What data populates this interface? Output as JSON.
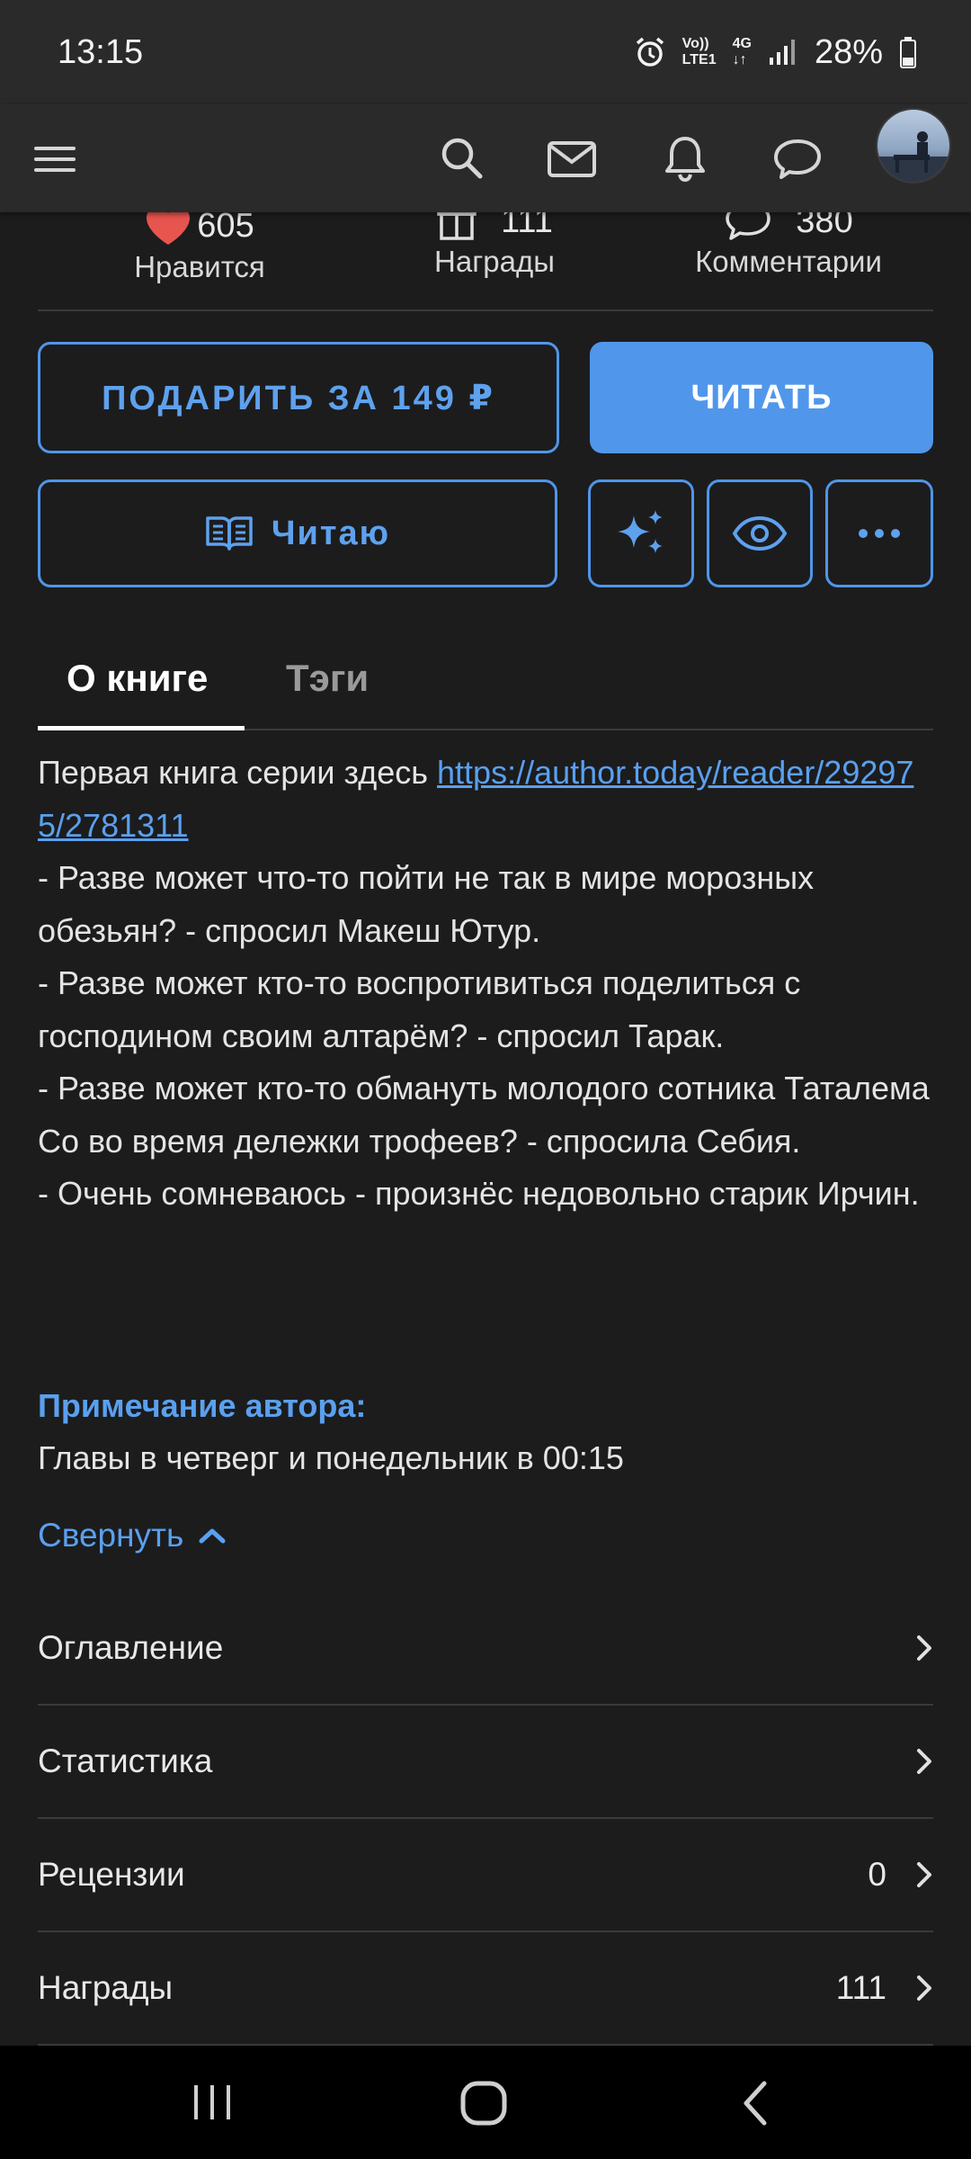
{
  "status_bar": {
    "time": "13:15",
    "volte_top": "Vo))",
    "volte_bottom": "LTE1",
    "network_top": "4G",
    "network_bottom": "↓↑",
    "battery": "28%"
  },
  "app_bar": {
    "icons": [
      "menu-icon",
      "search-icon",
      "mail-icon",
      "bell-icon",
      "chat-icon",
      "avatar"
    ]
  },
  "stats": {
    "likes": {
      "value": "605",
      "label": "Нравится"
    },
    "awards": {
      "value": "111",
      "label": "Награды"
    },
    "comments": {
      "value": "380",
      "label": "Комментарии"
    }
  },
  "actions": {
    "gift_label": "ПОДАРИТЬ ЗА 149 ₽",
    "read_label": "ЧИТАТЬ",
    "reading_label": "Читаю"
  },
  "tabs": [
    {
      "label": "О книге",
      "active": true
    },
    {
      "label": "Тэги",
      "active": false
    }
  ],
  "description": {
    "intro": "Первая книга серии здесь ",
    "link_text": "https://author.today/reader/292975/2781311",
    "lines": [
      "- Разве может что-то пойти не так в мире морозных обезьян? - спросил Макеш Ютур.",
      "- Разве может кто-то воспротивиться поделиться с господином своим алтарём? - спросил Тарак.",
      "- Разве может кто-то обмануть молодого сотника Таталема Со во время дележки трофеев? - спросила Себия.",
      "- Очень сомневаюсь - произнёс недовольно старик Ирчин."
    ]
  },
  "author_note": {
    "title": "Примечание автора:",
    "text": "Главы в четверг и понедельник в 00:15"
  },
  "collapse_label": "Свернуть",
  "list": [
    {
      "label": "Оглавление",
      "count": ""
    },
    {
      "label": "Статистика",
      "count": ""
    },
    {
      "label": "Рецензии",
      "count": "0"
    },
    {
      "label": "Награды",
      "count": "111"
    }
  ],
  "colors": {
    "accent": "#5097eb",
    "background": "#1c1c1d",
    "like": "#e8554e"
  }
}
